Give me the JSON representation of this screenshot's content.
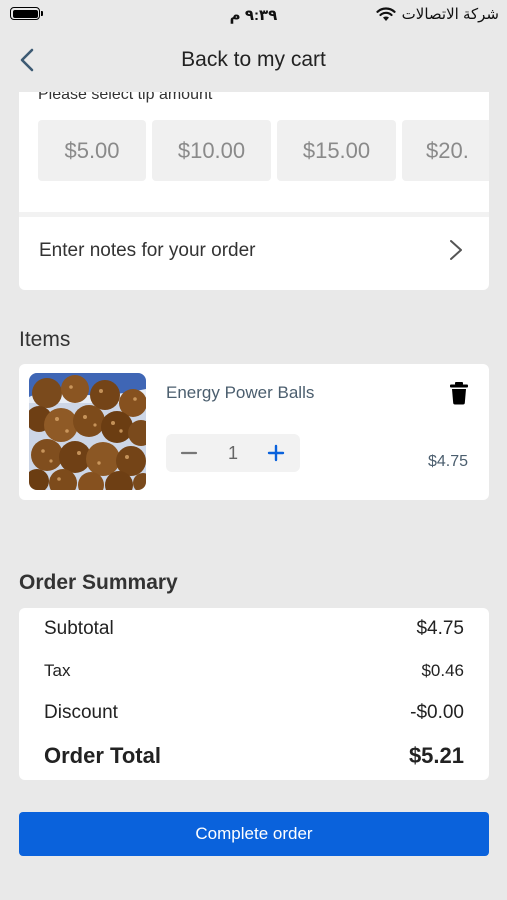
{
  "status_bar": {
    "time": "٩:٣٩ م",
    "carrier": "شركة الاتصالات"
  },
  "nav": {
    "title": "Back to my cart"
  },
  "tip": {
    "label": "Please select tip amount",
    "options": [
      "$5.00",
      "$10.00",
      "$15.00",
      "$20."
    ]
  },
  "notes": {
    "label": "Enter notes for your order"
  },
  "items_section": {
    "title": "Items",
    "items": [
      {
        "name": "Energy Power Balls",
        "quantity": "1",
        "price": "$4.75"
      }
    ]
  },
  "summary": {
    "title": "Order Summary",
    "subtotal_label": "Subtotal",
    "subtotal_value": "$4.75",
    "tax_label": "Tax",
    "tax_value": "$0.46",
    "discount_label": "Discount",
    "discount_value": "-$0.00",
    "total_label": "Order Total",
    "total_value": "$5.21"
  },
  "actions": {
    "complete_label": "Complete order"
  },
  "colors": {
    "accent": "#0a62dc",
    "background": "#e9e9e9",
    "card": "#ffffff",
    "tip_button": "#f0f0f0"
  }
}
